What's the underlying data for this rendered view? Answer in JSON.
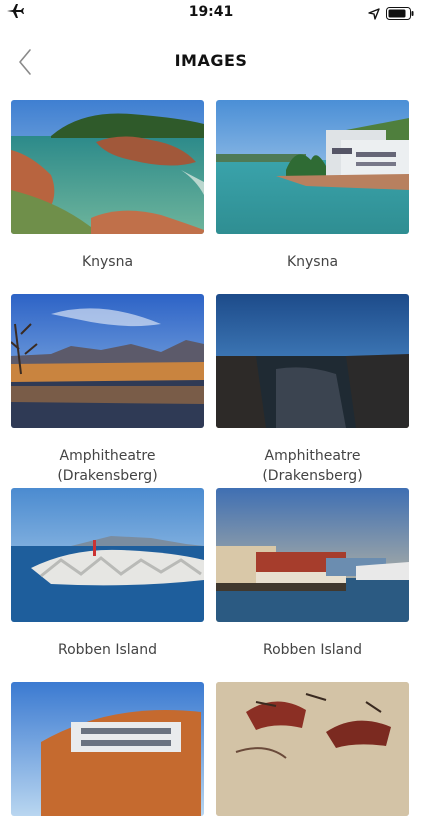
{
  "status_bar": {
    "time": "19:41",
    "icons": [
      "airplane-icon",
      "location-arrow-icon",
      "battery-icon"
    ]
  },
  "nav": {
    "title": "IMAGES",
    "back_icon": "chevron-left-icon"
  },
  "gallery": {
    "items": [
      {
        "caption": "Knysna"
      },
      {
        "caption": "Knysna"
      },
      {
        "caption": "Amphitheatre\n(Drakensberg)"
      },
      {
        "caption": "Amphitheatre\n(Drakensberg)"
      },
      {
        "caption": "Robben Island"
      },
      {
        "caption": "Robben Island"
      },
      {
        "caption": ""
      },
      {
        "caption": ""
      }
    ]
  }
}
